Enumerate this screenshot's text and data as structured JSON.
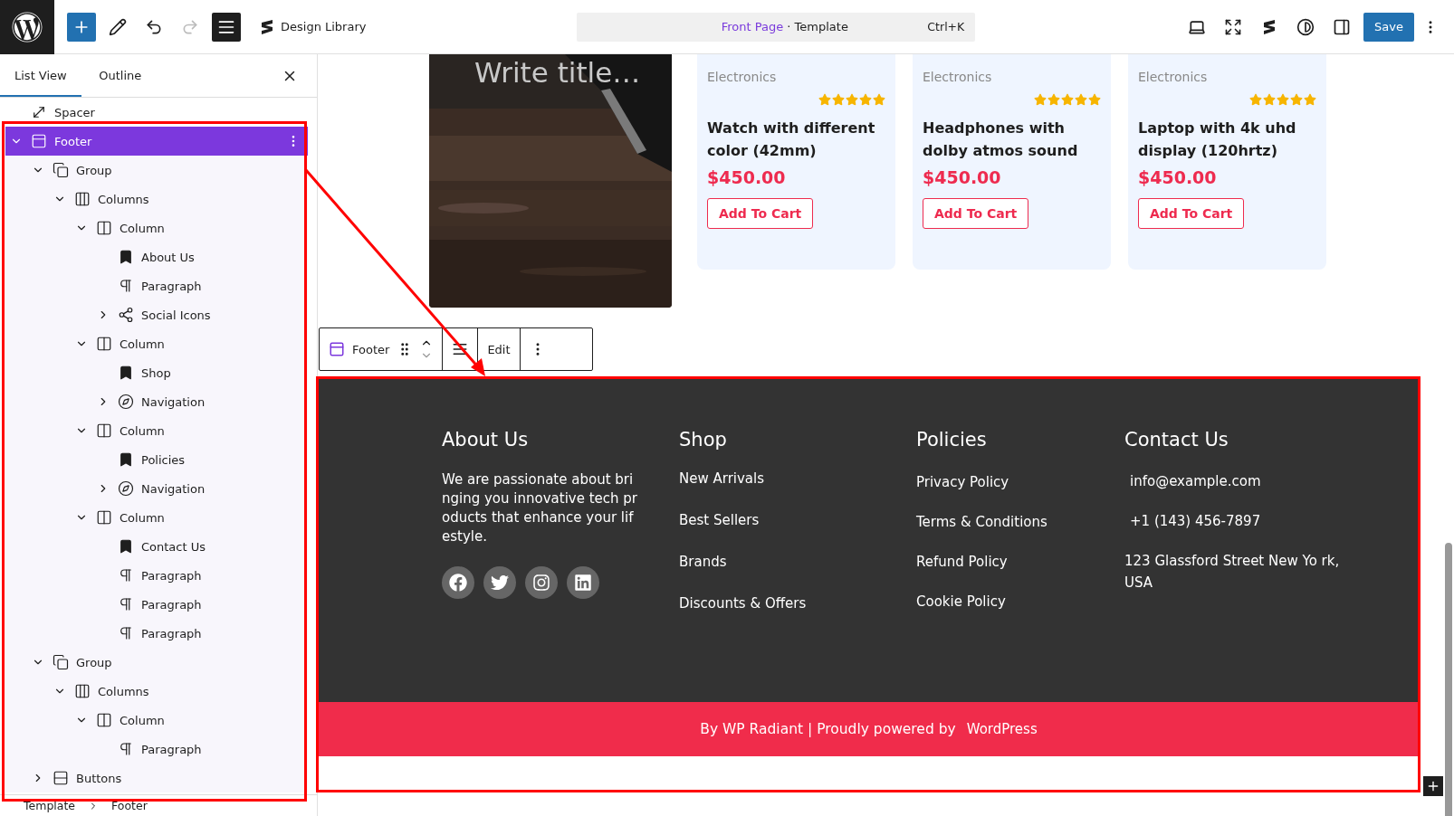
{
  "topbar": {
    "tools": [
      {
        "kind": "add",
        "selected": true
      },
      {
        "kind": "edit",
        "selected": false
      },
      {
        "kind": "undo",
        "selected": false,
        "disabled": false
      },
      {
        "kind": "redo",
        "selected": false,
        "disabled": true
      },
      {
        "kind": "listview",
        "selected": true
      }
    ],
    "library": "Design Library",
    "command": {
      "page": "Front Page",
      "separator": "· Template",
      "shortcut": "Ctrl+K"
    },
    "right_tools": [
      {
        "kind": "desktop"
      },
      {
        "kind": "fullscreen"
      },
      {
        "kind": "library"
      },
      {
        "kind": "styles"
      },
      {
        "kind": "settings"
      }
    ],
    "save": "Save"
  },
  "panel": {
    "tabs": [
      {
        "label": "List View",
        "selected": true
      },
      {
        "label": "Outline",
        "selected": false
      }
    ],
    "tree": [
      {
        "label": "Spacer",
        "kind": "spacer",
        "selected": false
      },
      {
        "label": "Footer",
        "kind": "footer",
        "selected": true,
        "expanded": true,
        "children": [
          {
            "label": "Group",
            "kind": "group",
            "expanded": true,
            "selected": false,
            "children": [
              {
                "label": "Columns",
                "kind": "columns",
                "expanded": true,
                "selected": false,
                "children": [
                  {
                    "label": "Column",
                    "kind": "column",
                    "expanded": true,
                    "selected": false,
                    "children": [
                      {
                        "label": "About Us",
                        "kind": "heading",
                        "selected": false
                      },
                      {
                        "label": "Paragraph",
                        "kind": "paragraph",
                        "selected": false
                      },
                      {
                        "label": "Social Icons",
                        "kind": "social",
                        "expanded": false,
                        "selected": false
                      }
                    ]
                  },
                  {
                    "label": "Column",
                    "kind": "column",
                    "expanded": true,
                    "selected": false,
                    "children": [
                      {
                        "label": "Shop",
                        "kind": "heading",
                        "selected": false
                      },
                      {
                        "label": "Navigation",
                        "kind": "navigation",
                        "expanded": false,
                        "selected": false
                      }
                    ]
                  },
                  {
                    "label": "Column",
                    "kind": "column",
                    "expanded": true,
                    "selected": false,
                    "children": [
                      {
                        "label": "Policies",
                        "kind": "heading",
                        "selected": false
                      },
                      {
                        "label": "Navigation",
                        "kind": "navigation",
                        "expanded": false,
                        "selected": false
                      }
                    ]
                  },
                  {
                    "label": "Column",
                    "kind": "column",
                    "expanded": true,
                    "selected": false,
                    "children": [
                      {
                        "label": "Contact Us",
                        "kind": "heading",
                        "selected": false
                      },
                      {
                        "label": "Paragraph",
                        "kind": "paragraph",
                        "selected": false
                      },
                      {
                        "label": "Paragraph",
                        "kind": "paragraph",
                        "selected": false
                      },
                      {
                        "label": "Paragraph",
                        "kind": "paragraph",
                        "selected": false
                      }
                    ]
                  }
                ]
              }
            ]
          },
          {
            "label": "Group",
            "kind": "group",
            "expanded": true,
            "selected": false,
            "children": [
              {
                "label": "Columns",
                "kind": "columns",
                "expanded": true,
                "selected": false,
                "children": [
                  {
                    "label": "Column",
                    "kind": "column",
                    "expanded": true,
                    "selected": false,
                    "children": [
                      {
                        "label": "Paragraph",
                        "kind": "paragraph",
                        "selected": false
                      }
                    ]
                  }
                ]
              }
            ]
          },
          {
            "label": "Buttons",
            "kind": "buttons",
            "expanded": false,
            "selected": false
          }
        ]
      }
    ],
    "breadcrumb": [
      "Template",
      "Footer"
    ]
  },
  "canvas": {
    "cover": {
      "kind": "picture",
      "placeholder": "Write title…"
    },
    "products": [
      {
        "category": "Electronics",
        "stars": 5,
        "title": "Watch with different color (42mm)",
        "price": "$450.00",
        "button": "Add To Cart"
      },
      {
        "category": "Electronics",
        "stars": 5,
        "title": "Headphones with dolby atmos sound",
        "price": "$450.00",
        "button": "Add To Cart"
      },
      {
        "category": "Electronics",
        "stars": 5,
        "title": "Laptop with 4k uhd display (120hrtz)",
        "price": "$450.00",
        "button": "Add To Cart"
      }
    ],
    "block_toolbar": {
      "label": "Footer",
      "edit": "Edit"
    },
    "footer": {
      "columns": [
        {
          "kind": "text",
          "heading": "About Us",
          "text": "We are passionate about bri nging you innovative tech pr oducts that enhance your lif estyle.",
          "social": [
            {
              "kind": "facebook"
            },
            {
              "kind": "twitter"
            },
            {
              "kind": "instagram"
            },
            {
              "kind": "linkedin"
            }
          ]
        },
        {
          "kind": "links",
          "heading": "Shop",
          "links": [
            "New Arrivals",
            "Best Sellers",
            "Brands",
            "Discounts & Offers"
          ]
        },
        {
          "kind": "links",
          "heading": "Policies",
          "links": [
            "Privacy Policy",
            "Terms & Conditions",
            "Refund Policy",
            "Cookie Policy"
          ]
        },
        {
          "kind": "contact",
          "heading": "Contact Us",
          "lines": [
            "info@example.com",
            "+1 (143) 456-7897",
            "123 Glassford Street New Yo rk, USA"
          ]
        }
      ],
      "credit": "By WP Radiant | Proudly powered by",
      "credit_link": "WordPress"
    }
  }
}
